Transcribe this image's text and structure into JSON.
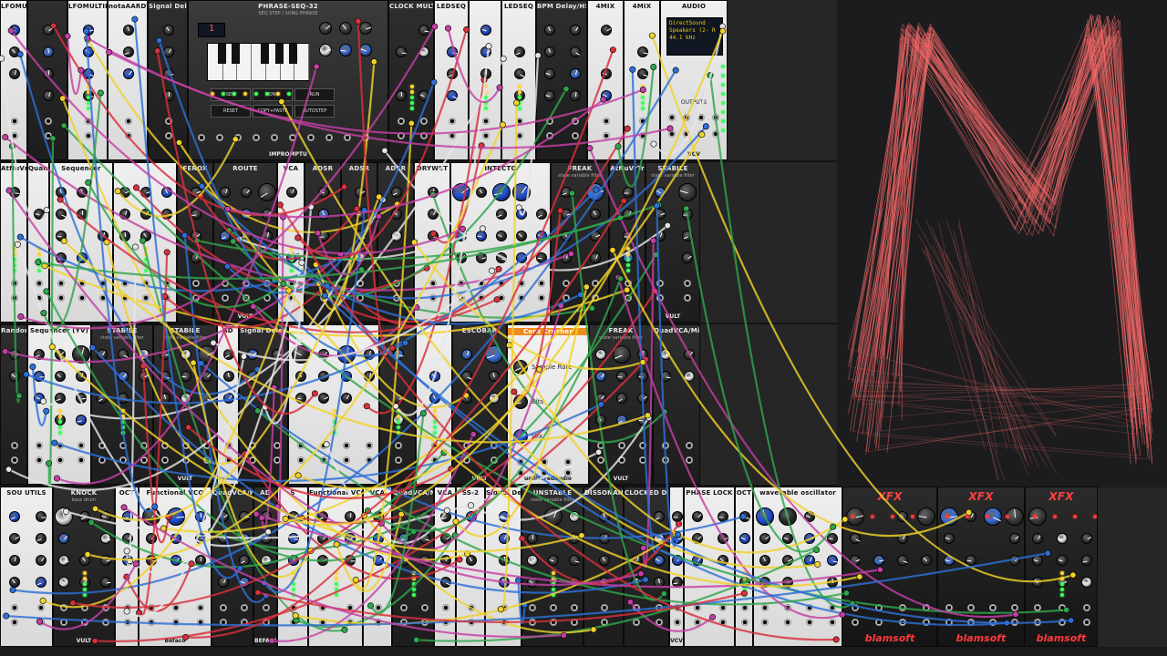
{
  "app": {
    "title": "VCV Rack"
  },
  "palette": {
    "scope_trace": "#f56a6a",
    "scope_bg": "#1c1c1e",
    "rack_bg": "#262626"
  },
  "rack": {
    "rows": [
      {
        "modules": [
          {
            "title": "LFOMULTIPHASE",
            "theme": "light",
            "brand": ""
          },
          {
            "title": "",
            "theme": "dark",
            "brand": ""
          },
          {
            "title": "LFOMULTIPHASE",
            "theme": "light",
            "brand": ""
          },
          {
            "title": "notaAARDVARK",
            "theme": "light",
            "brand": ""
          },
          {
            "title": "Signal Delay",
            "theme": "dark",
            "brand": ""
          },
          {
            "title": "PHRASE-SEQ-32",
            "subtitle": "SEQ STEP / SONG PHRASE",
            "theme": "dark",
            "brand": "IMPROMPTU",
            "kind": "sequencer"
          },
          {
            "title": "CLOCK MULT DIV",
            "theme": "dark",
            "brand": ""
          },
          {
            "title": "LEDSEQ",
            "theme": "light",
            "brand": ""
          },
          {
            "title": "",
            "theme": "light",
            "brand": ""
          },
          {
            "title": "LEDSEQ",
            "theme": "light",
            "brand": ""
          },
          {
            "title": "BPM Delay/HS Calc",
            "theme": "dark",
            "brand": ""
          },
          {
            "title": "4MIX",
            "theme": "light",
            "brand": ""
          },
          {
            "title": "4MIX",
            "theme": "light",
            "brand": ""
          },
          {
            "title": "AUDIO",
            "theme": "light",
            "brand": "VCV",
            "kind": "audio"
          }
        ]
      },
      {
        "modules": [
          {
            "title": "AtNuVrTr",
            "theme": "light",
            "brand": ""
          },
          {
            "title": "Quantizer",
            "theme": "light",
            "brand": ""
          },
          {
            "title": "Sequencer",
            "theme": "light",
            "brand": ""
          },
          {
            "title": "",
            "theme": "light",
            "brand": ""
          },
          {
            "title": "FEROX",
            "theme": "dark",
            "brand": ""
          },
          {
            "title": "ROUTE",
            "theme": "dark",
            "brand": "VULT"
          },
          {
            "title": "VCA",
            "theme": "light",
            "brand": ""
          },
          {
            "title": "ADSR",
            "theme": "dark",
            "brand": ""
          },
          {
            "title": "ADSR",
            "theme": "dark",
            "brand": ""
          },
          {
            "title": "ADSR",
            "theme": "dark",
            "brand": ""
          },
          {
            "title": "DRYWET",
            "theme": "light",
            "brand": ""
          },
          {
            "title": "INTECTO",
            "theme": "light",
            "brand": ""
          },
          {
            "title": "FREAK",
            "subtitle": "state variable filter",
            "theme": "dark",
            "brand": ""
          },
          {
            "title": "AtNuVrTr",
            "theme": "dark",
            "brand": ""
          },
          {
            "title": "STABILE",
            "subtitle": "state variable filter",
            "theme": "dark",
            "brand": "VULT"
          }
        ]
      },
      {
        "modules": [
          {
            "title": "Random",
            "theme": "dark",
            "brand": ""
          },
          {
            "title": "Sequencer (YV)",
            "theme": "light",
            "brand": ""
          },
          {
            "title": "STABILE",
            "subtitle": "state variable filter",
            "theme": "dark",
            "brand": ""
          },
          {
            "title": "STABILE",
            "subtitle": "state variable filter",
            "theme": "dark",
            "brand": "VULT"
          },
          {
            "title": "AD",
            "theme": "light",
            "brand": ""
          },
          {
            "title": "Signal Delay",
            "theme": "dark",
            "brand": ""
          },
          {
            "title": "",
            "theme": "light",
            "brand": ""
          },
          {
            "title": "",
            "theme": "dark",
            "brand": ""
          },
          {
            "title": "",
            "theme": "light",
            "brand": ""
          },
          {
            "title": "ESCOBAR",
            "theme": "dark",
            "brand": "VULT"
          },
          {
            "title": "Cent Crusher",
            "theme": "light",
            "brand": "unfilteredaudio",
            "kind": "crusher"
          },
          {
            "title": "FREAK",
            "subtitle": "state variable filter",
            "theme": "dark",
            "brand": "VULT"
          },
          {
            "title": "QuadVCA/Mixer",
            "theme": "dark",
            "brand": ""
          }
        ]
      },
      {
        "modules": [
          {
            "title": "SOU UTILS",
            "theme": "light",
            "brand": ""
          },
          {
            "title": "KNOCK",
            "subtitle": "bass drum",
            "theme": "dark",
            "brand": "VULT"
          },
          {
            "title": "OCT",
            "theme": "light",
            "brand": ""
          },
          {
            "title": "Functional VCO",
            "theme": "light",
            "brand": "Befaco"
          },
          {
            "title": "QuadVCA/Mixer",
            "theme": "dark",
            "brand": ""
          },
          {
            "title": "AD",
            "theme": "dark",
            "brand": "BEFACO"
          },
          {
            "title": "S",
            "theme": "light",
            "brand": ""
          },
          {
            "title": "Functional VCO",
            "theme": "light",
            "brand": ""
          },
          {
            "title": "VCA",
            "theme": "light",
            "brand": ""
          },
          {
            "title": "QuadVCA/Mixer",
            "theme": "dark",
            "brand": ""
          },
          {
            "title": "VCA",
            "theme": "light",
            "brand": ""
          },
          {
            "title": "SS-2",
            "theme": "light",
            "brand": ""
          },
          {
            "title": "Signal Delay",
            "theme": "light",
            "brand": ""
          },
          {
            "title": "UNSTABLE",
            "subtitle": "state variable filter",
            "theme": "dark",
            "brand": ""
          },
          {
            "title": "DISSONANTVERB",
            "theme": "dark",
            "brand": ""
          },
          {
            "title": "CLOCKED DELAY",
            "theme": "dark",
            "brand": ""
          },
          {
            "title": "",
            "theme": "light",
            "brand": "VCV"
          },
          {
            "title": "PHASE LOCK",
            "theme": "light",
            "brand": ""
          },
          {
            "title": "OCT",
            "theme": "light",
            "brand": ""
          },
          {
            "title": "wavetable oscillator",
            "theme": "light",
            "brand": ""
          },
          {
            "title": "XFX",
            "theme": "dark",
            "brand": "blamsoft"
          },
          {
            "title": "XFX",
            "theme": "dark",
            "brand": "blamsoft"
          },
          {
            "title": "XFX",
            "theme": "dark",
            "brand": "blamsoft"
          }
        ]
      }
    ]
  },
  "phrase_seq": {
    "display": "1",
    "buttons": [
      "SEQ",
      "SONG",
      "RUN",
      "RESET",
      "COPY+PASTE",
      "AUTOSTEP"
    ]
  },
  "audio_module": {
    "driver": "DirectSound",
    "device": "Speakers (2- R",
    "rate": "44.1 kHz",
    "outputs_label": "OUTPUTS"
  },
  "crusher": {
    "labels": [
      "Sample Rate",
      "Bits",
      "Mix"
    ]
  }
}
